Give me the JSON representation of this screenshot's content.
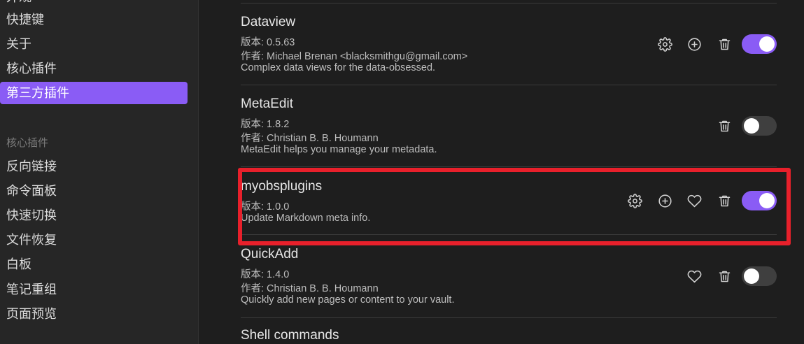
{
  "sidebar": {
    "cut_top": "外观",
    "items_top": [
      "快捷键",
      "关于",
      "核心插件",
      "第三方插件"
    ],
    "section_header": "核心插件",
    "items_core": [
      "反向链接",
      "命令面板",
      "快速切换",
      "文件恢复",
      "白板",
      "笔记重组",
      "页面预览"
    ]
  },
  "plugins": [
    {
      "name": "Dataview",
      "version": "版本: 0.5.63",
      "author": "作者: Michael Brenan <blacksmithgu@gmail.com>",
      "description": "Complex data views for the data-obsessed.",
      "enabled": true,
      "icons": [
        "gear-icon",
        "plus-circle-icon",
        "trash-icon"
      ]
    },
    {
      "name": "MetaEdit",
      "version": "版本: 1.8.2",
      "author": "作者: Christian B. B. Houmann",
      "description": "MetaEdit helps you manage your metadata.",
      "enabled": false,
      "icons": [
        "trash-icon"
      ]
    },
    {
      "name": "myobsplugins",
      "version": "版本: 1.0.0",
      "description": "Update Markdown meta info.",
      "enabled": true,
      "icons": [
        "gear-icon",
        "plus-circle-icon",
        "heart-icon",
        "trash-icon"
      ]
    },
    {
      "name": "QuickAdd",
      "version": "版本: 1.4.0",
      "author": "作者: Christian B. B. Houmann",
      "description": "Quickly add new pages or content to your vault.",
      "enabled": false,
      "icons": [
        "heart-icon",
        "trash-icon"
      ]
    },
    {
      "name": "Shell commands"
    }
  ],
  "colors": {
    "accent": "#8a5cf5",
    "highlight": "#e8202b",
    "background": "#1e1e1e",
    "sidebar": "#262626"
  }
}
